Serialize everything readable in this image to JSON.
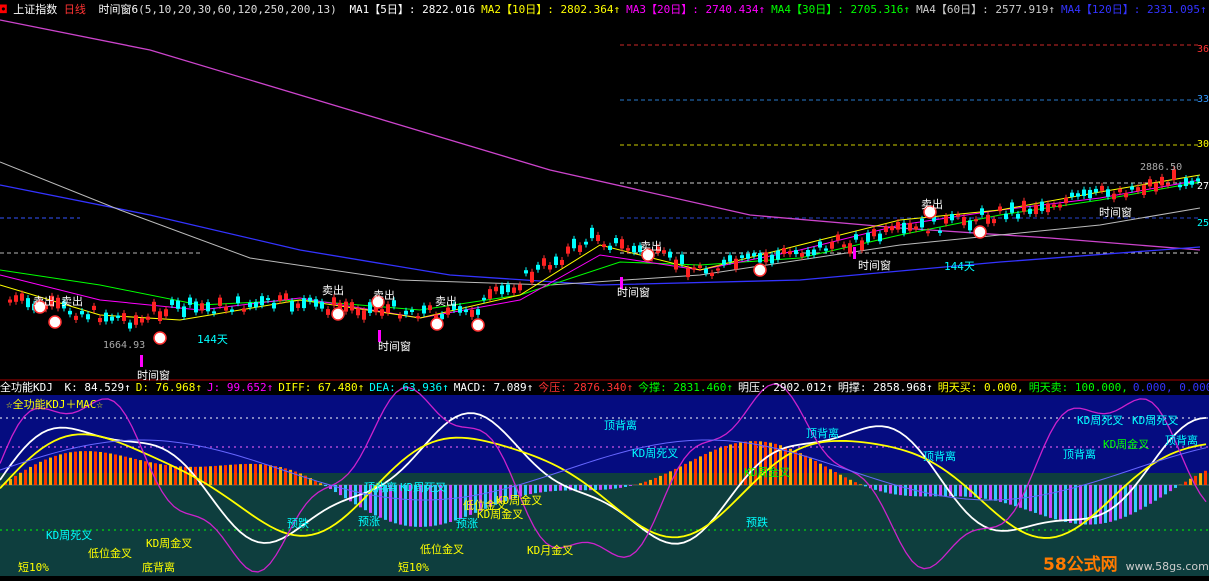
{
  "header": {
    "lock_glyph": "◘",
    "index_name": "上证指数",
    "period": "日线",
    "indicator": "时间窗6",
    "params": "(5,10,20,30,60,120,250,200,13)",
    "ma_items": [
      {
        "name": "MA1【5日】",
        "value": ": 2822.016",
        "color": "#ffffff"
      },
      {
        "name": "MA2【10日】",
        "value": ": 2802.364↑",
        "color": "#ffff00"
      },
      {
        "name": "MA3【20日】",
        "value": ": 2740.434↑",
        "color": "#ff00ff"
      },
      {
        "name": "MA4【30日】",
        "value": ": 2705.316↑",
        "color": "#00ff00"
      },
      {
        "name": "MA4【60日】",
        "value": ": 2577.919↑",
        "color": "#cccccc"
      },
      {
        "name": "MA4【120日】",
        "value": ": 2331.095↑",
        "color": "#3333ff"
      },
      {
        "name": "MA4",
        "value": "",
        "color": "#ffffff"
      }
    ]
  },
  "price_axis": [
    "36",
    "33",
    "30",
    "27",
    "25"
  ],
  "annotations": {
    "sell": "卖出",
    "time_window": "时间窗",
    "days_144": "144天",
    "low_value": "1664.93",
    "high_value": "2886.50"
  },
  "kdj_header": {
    "title": "全功能KDJ",
    "items": [
      {
        "label": "K: 84.529↑",
        "color": "#ffffff"
      },
      {
        "label": "D: 76.968↑",
        "color": "#ffff00"
      },
      {
        "label": "J: 99.652↑",
        "color": "#ff00ff"
      },
      {
        "label": "DIFF: 67.480↑",
        "color": "#ffff00"
      },
      {
        "label": "DEA: 63.936↑",
        "color": "#00ffff"
      },
      {
        "label": "MACD: 7.089↑",
        "color": "#ffffff"
      },
      {
        "label": "今压: 2876.340↑",
        "color": "#ff3333"
      },
      {
        "label": "今撑: 2831.460↑",
        "color": "#00ff00"
      },
      {
        "label": "明压: 2902.012↑",
        "color": "#ffffff"
      },
      {
        "label": "明撑: 2858.968↑",
        "color": "#ffffff"
      },
      {
        "label": "明天买: 0.000,",
        "color": "#ffff00"
      },
      {
        "label": "明天卖: 100.000,",
        "color": "#00ff00"
      },
      {
        "label": "0.000, 0.000, 0.",
        "color": "#3333ff"
      }
    ]
  },
  "kdj_subtitle": "☆全功能KDJ＋MAC☆",
  "kdj_labels": {
    "kd_dead": "KD周死叉",
    "kd_golden": "KD周金叉",
    "top_div": "顶背离",
    "bottom_div": "底背离",
    "low_golden": "低位金叉",
    "predict_fall": "预跌",
    "predict_rise": "预涨",
    "kd_month_golden": "KD月金叉",
    "short_10": "短10%"
  },
  "watermark": {
    "brand": "58公式网",
    "url": "www.58gs.com"
  }
}
